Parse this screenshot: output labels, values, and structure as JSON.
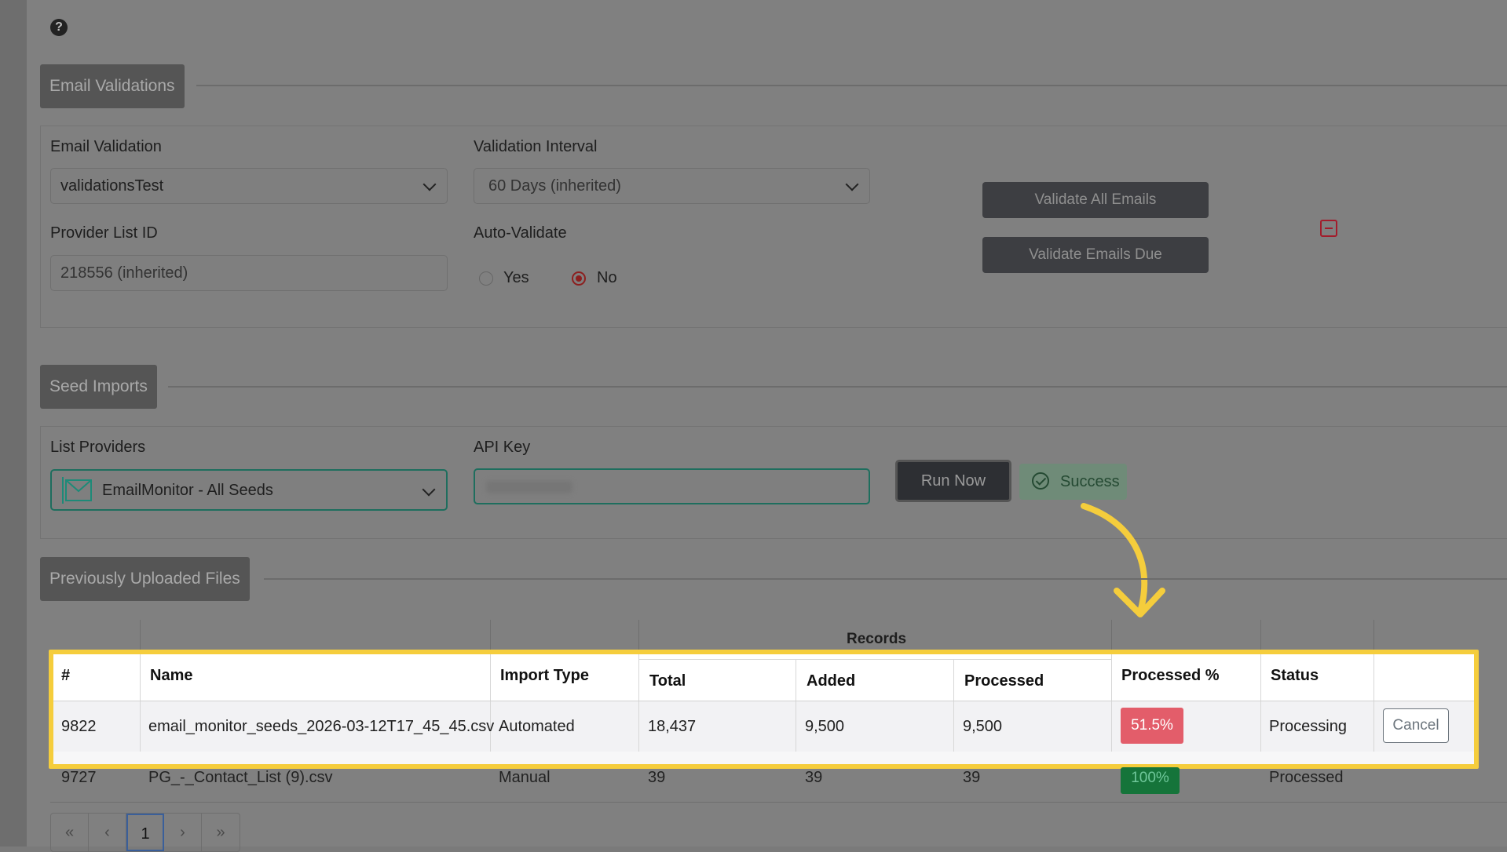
{
  "email_validations": {
    "section_title": "Email Validations",
    "email_validation_label": "Email Validation",
    "email_validation_value": "validationsTest",
    "interval_label": "Validation Interval",
    "interval_value": "60 Days (inherited)",
    "provider_list_label": "Provider List ID",
    "provider_list_value": "218556 (inherited)",
    "auto_validate_label": "Auto-Validate",
    "auto_validate_yes": "Yes",
    "auto_validate_no": "No",
    "auto_validate_selected": "No",
    "validate_all_label": "Validate All Emails",
    "validate_due_label": "Validate Emails Due"
  },
  "seed_imports": {
    "section_title": "Seed Imports",
    "list_providers_label": "List Providers",
    "list_providers_value": "EmailMonitor - All Seeds",
    "api_key_label": "API Key",
    "run_now_label": "Run Now",
    "status_label": "Success"
  },
  "uploaded_files": {
    "section_title": "Previously Uploaded Files",
    "records_group": "Records",
    "columns": {
      "id": "#",
      "name": "Name",
      "import_type": "Import Type",
      "total": "Total",
      "added": "Added",
      "processed": "Processed",
      "processed_pct": "Processed %",
      "status": "Status"
    },
    "rows": [
      {
        "id": "9822",
        "name": "email_monitor_seeds_2026-03-12T17_45_45.csv",
        "import_type": "Automated",
        "total": "18,437",
        "added": "9,500",
        "processed": "9,500",
        "processed_pct": "51.5%",
        "status": "Processing",
        "action": "Cancel"
      },
      {
        "id": "9727",
        "name": "PG_-_Contact_List (9).csv",
        "import_type": "Manual",
        "total": "39",
        "added": "39",
        "processed": "39",
        "processed_pct": "100%",
        "status": "Processed"
      }
    ],
    "pagination": {
      "first": "«",
      "prev": "‹",
      "current": "1",
      "next": "›",
      "last": "»"
    }
  },
  "colors": {
    "highlight": "#f5cd3c",
    "pct_partial": "#dc3545",
    "pct_complete": "#198754",
    "success": "#254a33"
  }
}
